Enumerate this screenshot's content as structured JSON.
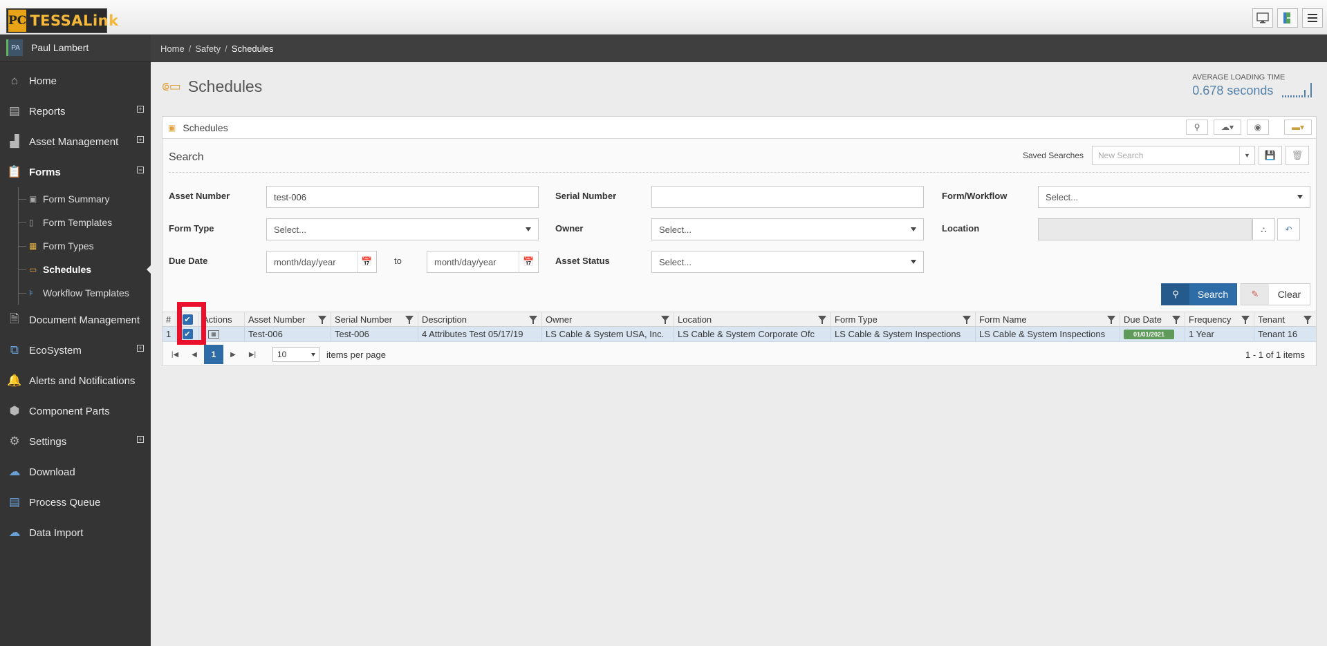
{
  "app": {
    "logo_mark": "PC",
    "logo_text": "TESSALink"
  },
  "top_icons": [
    "monitor-icon",
    "exit-icon",
    "menu-icon"
  ],
  "user": {
    "initials": "PA",
    "name": "Paul Lambert"
  },
  "nav": [
    {
      "label": "Home",
      "icon": "home-icon",
      "expandable": false
    },
    {
      "label": "Reports",
      "icon": "reports-icon",
      "expandable": true
    },
    {
      "label": "Asset Management",
      "icon": "factory-icon",
      "expandable": true
    },
    {
      "label": "Forms",
      "icon": "clipboard-icon",
      "expandable": true,
      "expanded": true
    }
  ],
  "forms_sub": [
    {
      "label": "Form Summary"
    },
    {
      "label": "Form Templates"
    },
    {
      "label": "Form Types"
    },
    {
      "label": "Schedules",
      "active": true
    },
    {
      "label": "Workflow Templates"
    }
  ],
  "nav2": [
    {
      "label": "Document Management",
      "icon": "document-icon",
      "expandable": false
    },
    {
      "label": "EcoSystem",
      "icon": "ecosystem-icon",
      "expandable": true
    },
    {
      "label": "Alerts and Notifications",
      "icon": "bell-icon",
      "expandable": false
    },
    {
      "label": "Component Parts",
      "icon": "cube-icon",
      "expandable": false
    },
    {
      "label": "Settings",
      "icon": "gear-icon",
      "expandable": true
    },
    {
      "label": "Download",
      "icon": "download-icon",
      "expandable": false
    },
    {
      "label": "Process Queue",
      "icon": "queue-icon",
      "expandable": false
    },
    {
      "label": "Data Import",
      "icon": "upload-icon",
      "expandable": false
    }
  ],
  "breadcrumb": {
    "home": "Home",
    "section": "Safety",
    "current": "Schedules"
  },
  "page": {
    "title": "Schedules"
  },
  "loading": {
    "label": "AVERAGE LOADING TIME",
    "value": "0.678 seconds"
  },
  "panel": {
    "title": "Schedules",
    "search_title": "Search",
    "saved_searches_label": "Saved Searches",
    "saved_searches_placeholder": "New Search"
  },
  "filters": {
    "asset_number": {
      "label": "Asset Number",
      "value": "test-006"
    },
    "serial_number": {
      "label": "Serial Number",
      "value": ""
    },
    "form_workflow": {
      "label": "Form/Workflow",
      "value": "Select..."
    },
    "form_type": {
      "label": "Form Type",
      "value": "Select..."
    },
    "owner": {
      "label": "Owner",
      "value": "Select..."
    },
    "location": {
      "label": "Location",
      "value": ""
    },
    "due_date": {
      "label": "Due Date",
      "from": "month/day/year",
      "to_label": "to",
      "to": "month/day/year"
    },
    "asset_status": {
      "label": "Asset Status",
      "value": "Select..."
    }
  },
  "buttons": {
    "search": "Search",
    "clear": "Clear"
  },
  "grid": {
    "headers": [
      "#",
      "",
      "Actions",
      "Asset Number",
      "Serial Number",
      "Description",
      "Owner",
      "Location",
      "Form Type",
      "Form Name",
      "Due Date",
      "Frequency",
      "Tenant"
    ],
    "rows": [
      {
        "num": "1",
        "asset_number": "Test-006",
        "serial_number": "Test-006",
        "description": "4 Attributes Test 05/17/19",
        "owner": "LS Cable & System USA, Inc.",
        "location": "LS Cable & System Corporate Ofc",
        "form_type": "LS Cable & System Inspections",
        "form_name": "LS Cable & System Inspections",
        "due_date": "01/01/2021",
        "frequency": "1 Year",
        "tenant": "Tenant 16"
      }
    ]
  },
  "pager": {
    "current_page": "1",
    "per_page": "10",
    "per_page_label": "items per page",
    "info": "1 - 1 of 1 items"
  },
  "colors": {
    "accent": "#2e6ca8",
    "sidebar": "#343434",
    "highlight": "#e8102b",
    "due_badge": "#5f9a5a"
  }
}
